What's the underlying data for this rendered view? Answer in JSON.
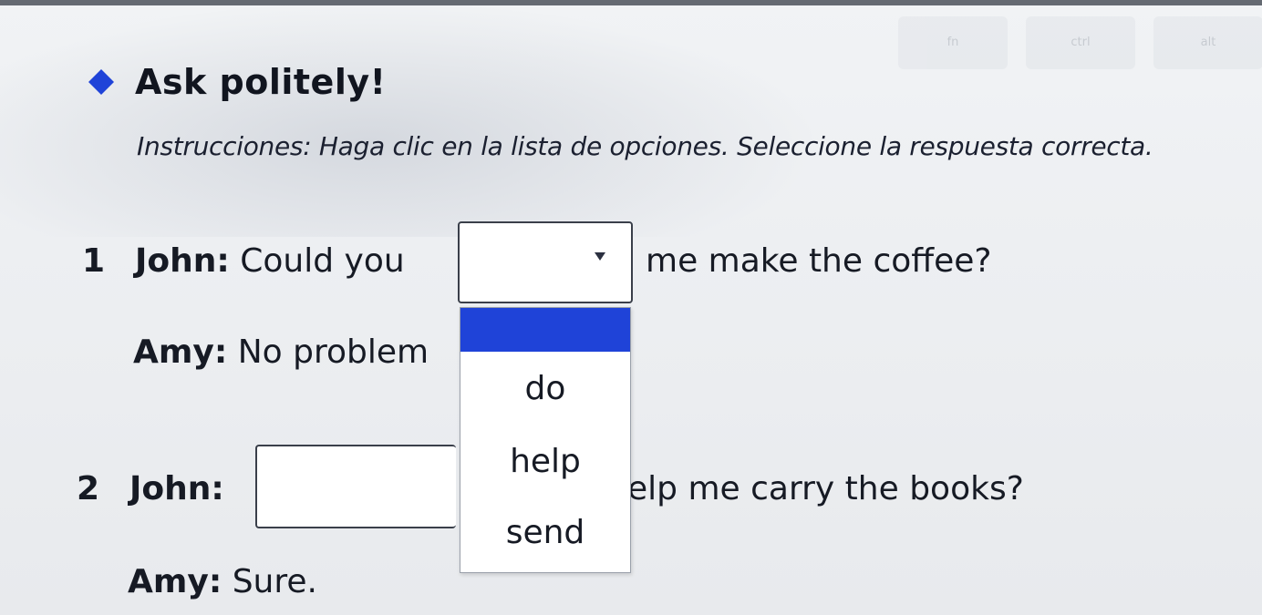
{
  "background": {
    "keys": [
      "fn",
      "ctrl",
      "alt"
    ]
  },
  "header": {
    "title": "Ask politely!",
    "instructions": "Instrucciones: Haga clic en la lista de opciones. Seleccione la respuesta correcta.",
    "icon": "diamond-bullet-icon",
    "accent_color": "#1f43d8"
  },
  "questions": [
    {
      "number": "1",
      "speaker": "John:",
      "before": "Could you",
      "after": "me make the coffee?",
      "selected_value": "",
      "answer_speaker": "Amy:",
      "answer_text": "No problem"
    },
    {
      "number": "2",
      "speaker": "John:",
      "before": "",
      "after": "elp me carry the books?",
      "selected_value": "",
      "answer_speaker": "Amy:",
      "answer_text": "Sure."
    }
  ],
  "dropdown": {
    "highlighted_option": "",
    "options": [
      "do",
      "help",
      "send"
    ],
    "chevron_icon": "chevron-down-icon"
  }
}
